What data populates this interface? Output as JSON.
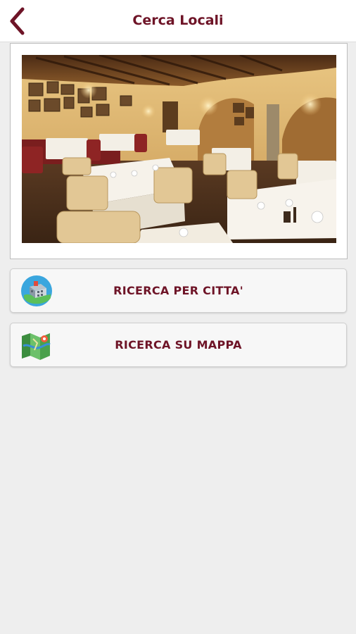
{
  "header": {
    "title": "Cerca Locali",
    "back_icon": "chevron-left-icon"
  },
  "hero": {
    "image": "restaurant-dining-room-photo"
  },
  "actions": [
    {
      "label": "RICERCA PER CITTA'",
      "icon": "city-globe-icon"
    },
    {
      "label": "RICERCA SU MAPPA",
      "icon": "folded-map-icon"
    }
  ],
  "colors": {
    "brand": "#6e1427",
    "background": "#eeeeee",
    "button_background": "#f7f7f7"
  }
}
